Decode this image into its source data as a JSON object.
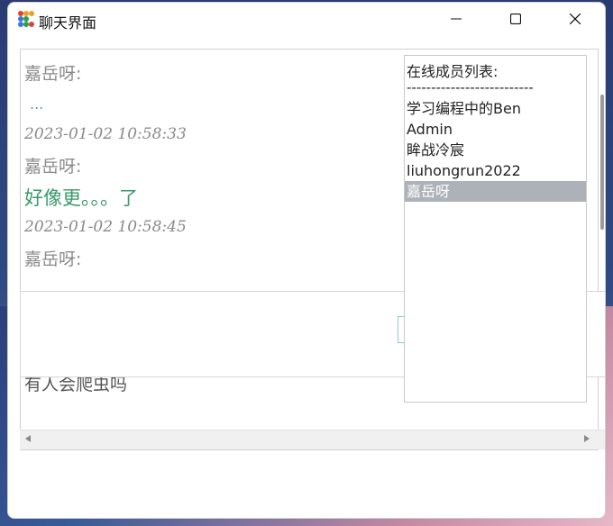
{
  "window": {
    "title": "聊天界面",
    "controls": {
      "minimize": "minimize-icon",
      "maximize": "maximize-icon",
      "close": "close-icon"
    }
  },
  "chat": {
    "messages": [
      {
        "name": "嘉岳呀:",
        "text": "...",
        "time": "2023-01-02 10:58:33"
      },
      {
        "name": "嘉岳呀:",
        "text": "好像更。。。了",
        "time": "2023-01-02 10:58:45"
      },
      {
        "name": "嘉岳呀:"
      }
    ],
    "partial_message": "有人会爬虫吗"
  },
  "members": {
    "header": "在线成员列表:",
    "separator": "--------------------------",
    "items": [
      "学习编程中的Ben",
      "Admin",
      "眸战冷宸",
      "liuhongrun2022",
      "嘉岳呀"
    ],
    "selected_index": 4
  },
  "colors": {
    "accent_green": "#3a9a6b",
    "selection": "#adb2b8"
  }
}
